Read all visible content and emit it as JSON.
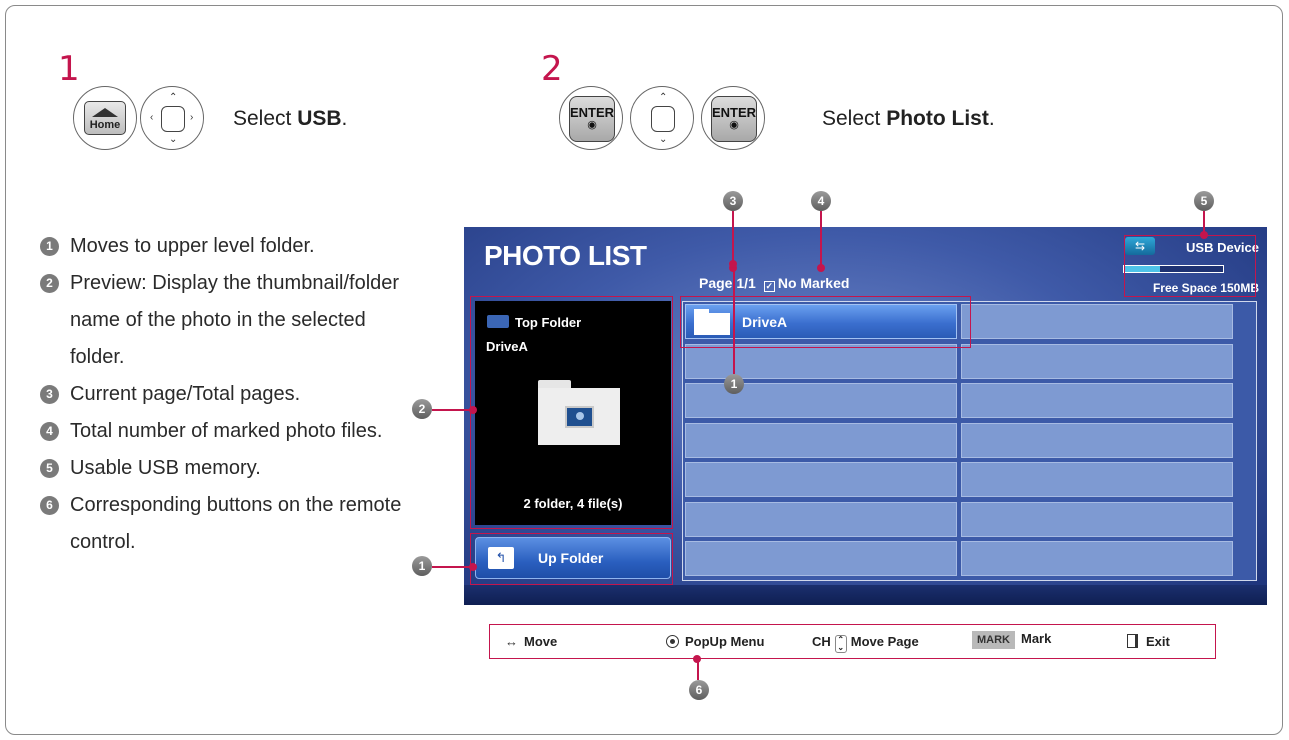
{
  "steps": [
    {
      "number": "1",
      "keys": [
        "home-key",
        "nav-key"
      ],
      "home_label": "Home",
      "instruction_prefix": "Select ",
      "instruction_bold": "USB",
      "instruction_suffix": "."
    },
    {
      "number": "2",
      "keys": [
        "enter-key",
        "nav-key",
        "enter-key"
      ],
      "enter_label": "ENTER",
      "instruction_prefix": "Select ",
      "instruction_bold": "Photo List",
      "instruction_suffix": "."
    }
  ],
  "descriptions": [
    {
      "n": "1",
      "text": "Moves to upper level folder."
    },
    {
      "n": "2",
      "text": "Preview: Display the thumbnail/folder name of the photo in the selected folder."
    },
    {
      "n": "3",
      "text": "Current page/Total pages."
    },
    {
      "n": "4",
      "text": "Total number of marked photo files."
    },
    {
      "n": "5",
      "text": "Usable USB memory."
    },
    {
      "n": "6",
      "text": "Corresponding buttons on the remote control."
    }
  ],
  "callouts": [
    "1",
    "2",
    "3",
    "4",
    "5",
    "6"
  ],
  "screen": {
    "title": "PHOTO LIST",
    "page": "Page 1/1",
    "marked": "No Marked",
    "usb_label": "USB Device",
    "usb_used_fraction": 0.36,
    "free_space": "Free Space 150MB",
    "preview": {
      "top_folder": "Top Folder",
      "drive": "DriveA",
      "count": "2 folder, 4 file(s)"
    },
    "up_folder": "Up Folder",
    "grid_selected": "DriveA",
    "grid_rows": 7,
    "grid_cols": 2
  },
  "footer": {
    "move": "Move",
    "popup": "PopUp Menu",
    "ch": "CH",
    "move_page": "Move Page",
    "mark_key": "MARK",
    "mark": "Mark",
    "exit": "Exit"
  },
  "colors": {
    "accent": "#c4154d",
    "screen_blue": "#3f5aa8",
    "cell_blue": "#7e9ad2",
    "selected_blue": "#3b6fcf"
  }
}
